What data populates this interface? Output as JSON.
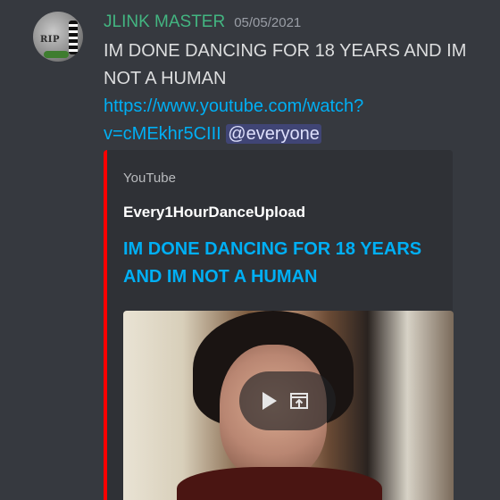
{
  "message": {
    "username": "JLINK MASTER",
    "timestamp": "05/05/2021",
    "text": "IM DONE DANCING FOR 18 YEARS AND IM NOT A HUMAN",
    "link": "https://www.youtube.com/watch?v=cMEkhr5CIII",
    "mention": "@everyone",
    "avatar_text": "RIP"
  },
  "embed": {
    "provider": "YouTube",
    "author": "Every1HourDanceUpload",
    "title": "IM DONE DANCING FOR 18 YEARS AND IM NOT A HUMAN",
    "accent_color": "#ff0000",
    "icons": [
      "play-icon",
      "open-external-icon"
    ]
  },
  "colors": {
    "background": "#36393f",
    "embed_background": "#2f3136",
    "username": "#43b581",
    "link": "#00aff4",
    "mention_bg": "#4e568f"
  }
}
